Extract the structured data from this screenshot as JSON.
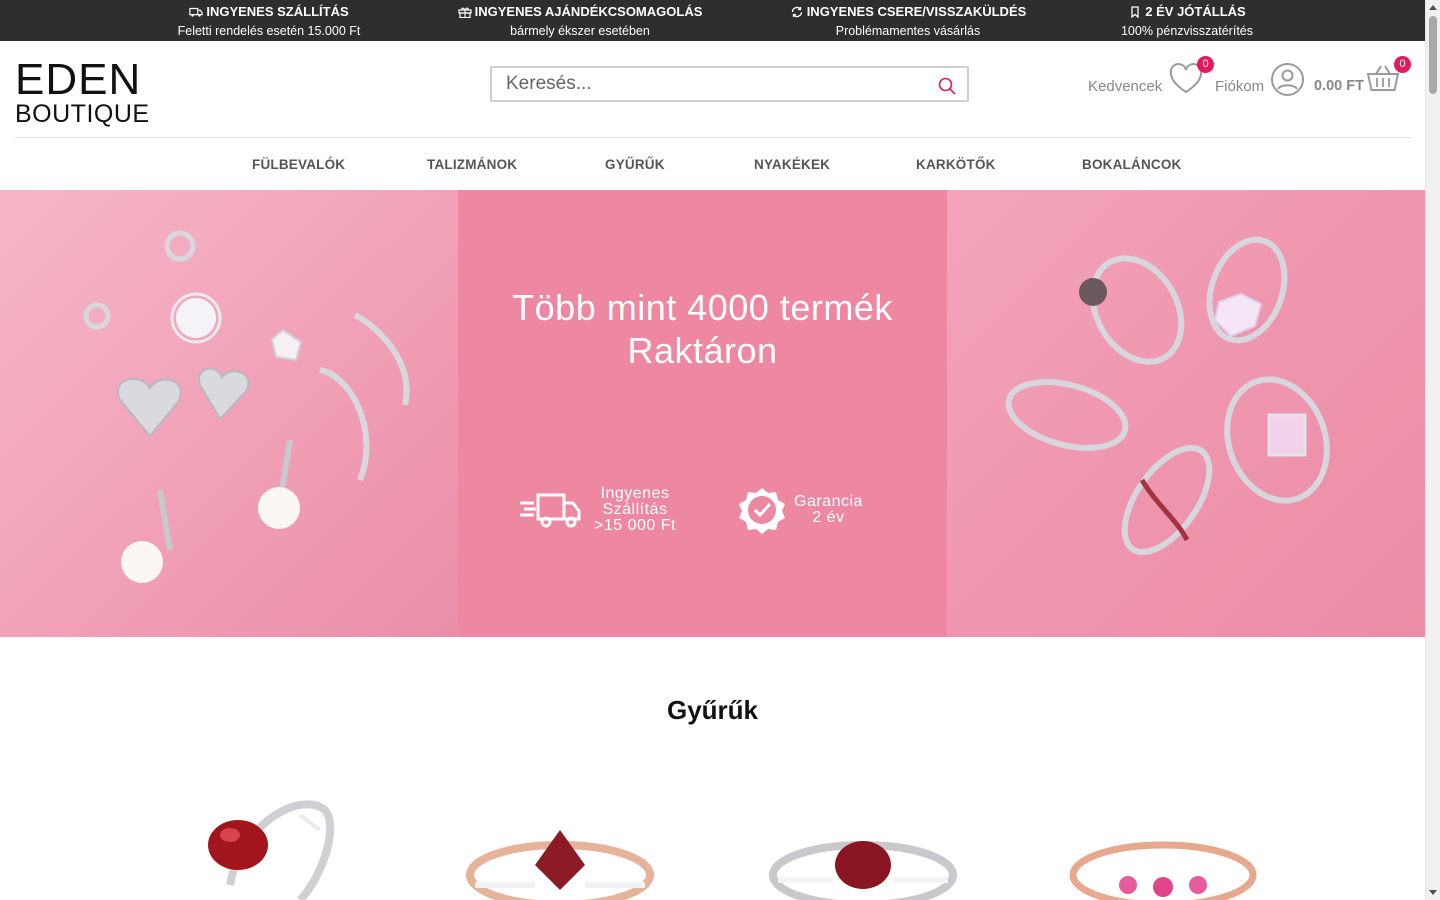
{
  "promos": [
    {
      "title": "INGYENES SZÁLLÍTÁS",
      "subtitle": "Feletti rendelés esetén 15.000 Ft",
      "icon": "truck-icon"
    },
    {
      "title": "INGYENES AJÁNDÉKCSOMAGOLÁS",
      "subtitle": "bármely ékszer esetében",
      "icon": "gift-icon"
    },
    {
      "title": "INGYENES CSERE/VISSZAKÜLDÉS",
      "subtitle": "Problémamentes vásárlás",
      "icon": "refresh-icon"
    },
    {
      "title": "2 ÉV JÓTÁLLÁS",
      "subtitle": "100% pénzvisszatérítés",
      "icon": "bookmark-icon"
    }
  ],
  "logo": {
    "line1": "EDEN",
    "line2": "BOUTIQUE"
  },
  "search": {
    "placeholder": "Keresés..."
  },
  "header": {
    "favorites_label": "Kedvencek",
    "favorites_count": "0",
    "account_label": "Fiókom",
    "cart_total": "0.00 FT",
    "cart_count": "0"
  },
  "nav": [
    "FÜLBEVALÓK",
    "TALIZMÁNOK",
    "GYŰRŰK",
    "NYAKÉKEK",
    "KARKÖTŐK",
    "BOKALÁNCOK"
  ],
  "banner": {
    "headline_line1": "Több mint 4000 termék",
    "headline_line2": "Raktáron",
    "shipping": {
      "line1": "Ingyenes",
      "line2": "Szállítás",
      "line3": ">15 000 Ft"
    },
    "warranty": {
      "line1": "Garancia",
      "line2": "2 év"
    }
  },
  "section_title": "Gyűrűk",
  "colors": {
    "topbar": "#2e2e2e",
    "accent": "#e5195e",
    "banner_pink": "#ed87a2"
  }
}
